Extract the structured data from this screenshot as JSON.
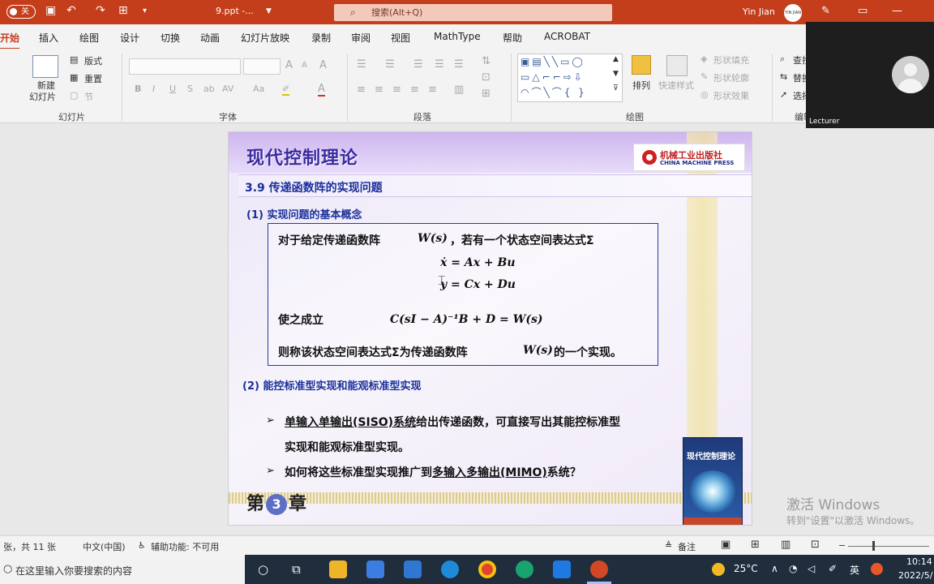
{
  "titlebar": {
    "autosave": "关",
    "filename": "9.ppt  -...",
    "search_placeholder": "搜索(Alt+Q)",
    "user_name": "Yin Jian",
    "user_avatar_text": "YIN JIAN"
  },
  "tabs": [
    "开始",
    "插入",
    "绘图",
    "设计",
    "切换",
    "动画",
    "幻灯片放映",
    "录制",
    "审阅",
    "视图",
    "MathType",
    "帮助",
    "ACROBAT"
  ],
  "ribbon": {
    "slides": {
      "new_slide": "新建",
      "new_slide2": "幻灯片",
      "layout": "版式",
      "reset": "重置",
      "section": "节",
      "group": "幻灯片"
    },
    "font": {
      "group": "字体",
      "bold": "B",
      "italic": "I",
      "underline": "U",
      "strike": "S",
      "shadow": "ab",
      "spacing": "AV",
      "case": "Aa",
      "grow": "A",
      "shrink": "A",
      "clear": "A",
      "color": "A"
    },
    "paragraph": {
      "group": "段落"
    },
    "drawing": {
      "group": "绘图",
      "arrange": "排列",
      "quick_styles": "快速样式",
      "fill": "形状填充",
      "outline": "形状轮廓",
      "effects": "形状效果"
    },
    "editing": {
      "find": "查找",
      "replace": "替换",
      "select": "选择",
      "group": "编辑"
    }
  },
  "lecturer": {
    "label": "Lecturer"
  },
  "slide": {
    "title": "现代控制理论",
    "press_cn": "机械工业出版社",
    "press_en": "CHINA MACHINE PRESS",
    "section": "3.9  传递函数阵的实现问题",
    "sub1": "(1)  实现问题的基本概念",
    "def_line1_a": "对于给定传递函数阵",
    "def_line1_math": "W(s)",
    "def_line1_b": "，若有一个状态空间表达式Σ",
    "eq1": "ẋ = Ax + Bu",
    "eq2": "y = Cx + Du",
    "def_line2": "使之成立",
    "eq3": "C(sI − A)⁻¹B + D = W(s)",
    "def_line3_a": "则称该状态空间表达式Σ为传递函数阵",
    "def_line3_math": "W(s)",
    "def_line3_b": "的一个实现。",
    "sub2": "(2)  能控标准型实现和能观标准型实现",
    "b1_a": "单输入单输出",
    "b1_b": "(SISO)",
    "b1_c": "系统",
    "b1_d": "给出传递函数，可直接写出其能控标准型",
    "b1_line2": "实现和能观标准型实现。",
    "b2_a": "如何将这些标准型实现推广到",
    "b2_b": "多输入多输出",
    "b2_c": "(MIMO)",
    "b2_d": "系统？",
    "chapter_pre": "第",
    "chapter_num": "3",
    "chapter_post": "章",
    "book_title": "现代控制理论"
  },
  "watermark": {
    "line1": "激活 Windows",
    "line2": "转到\"设置\"以激活 Windows。"
  },
  "statusbar": {
    "slide_count": "张，共 11 张",
    "language": "中文(中国)",
    "accessibility": "辅助功能: 不可用",
    "notes": "备注"
  },
  "taskbar": {
    "search": "在这里输入你要搜索的内容",
    "weather": "25°C",
    "ime": "英",
    "time": "10:14",
    "date": "2022/5/"
  }
}
